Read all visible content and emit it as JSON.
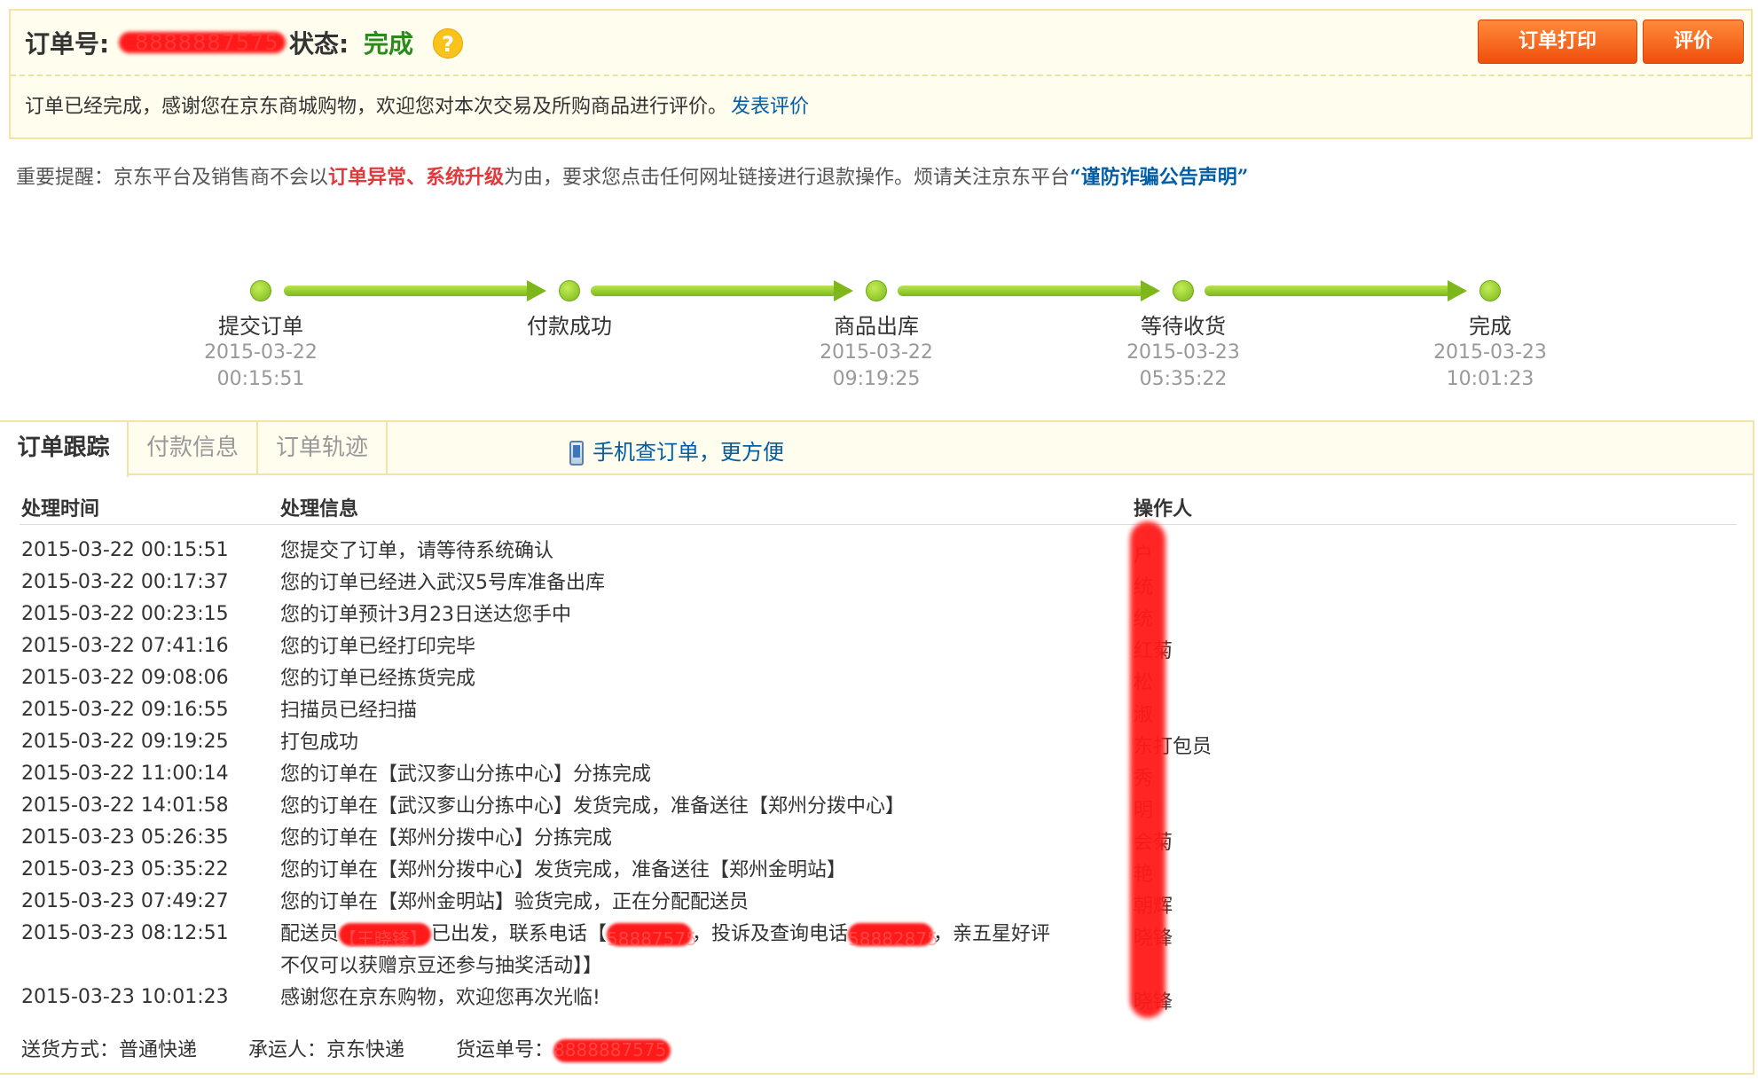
{
  "header": {
    "order_label": "订单号:",
    "order_no": "8888887575",
    "status_label": "状态:",
    "status_value": "完成",
    "help_icon": "?",
    "print_button": "订单打印",
    "review_button": "评价",
    "message": "订单已经完成，感谢您在京东商城购物，欢迎您对本次交易及所购商品进行评价。",
    "message_link": "发表评价"
  },
  "notice": {
    "prefix": "重要提醒：京东平台及销售商不会以",
    "highlight1": "订单异常、",
    "highlight2": "系统升级",
    "middle": "为由，要求您点击任何网址链接进行退款操作。烦请关注京东平台",
    "link": "“谨防诈骗公告声明”"
  },
  "progress": [
    {
      "name": "提交订单",
      "date": "2015-03-22",
      "time": "00:15:51"
    },
    {
      "name": "付款成功",
      "date": "",
      "time": ""
    },
    {
      "name": "商品出库",
      "date": "2015-03-22",
      "time": "09:19:25"
    },
    {
      "name": "等待收货",
      "date": "2015-03-23",
      "time": "05:35:22"
    },
    {
      "name": "完成",
      "date": "2015-03-23",
      "time": "10:01:23"
    }
  ],
  "tabs": {
    "tracking": "订单跟踪",
    "payment": "付款信息",
    "path": "订单轨迹",
    "mobile_link": "手机查订单，更方便"
  },
  "table": {
    "headers": {
      "time": "处理时间",
      "info": "处理信息",
      "operator": "操作人"
    },
    "rows": [
      {
        "time": "2015-03-22 00:15:51",
        "info": "您提交了订单，请等待系统确认",
        "operator": "户"
      },
      {
        "time": "2015-03-22 00:17:37",
        "info": "您的订单已经进入武汉5号库准备出库",
        "operator": "统"
      },
      {
        "time": "2015-03-22 00:23:15",
        "info": "您的订单预计3月23日送达您手中",
        "operator": "统"
      },
      {
        "time": "2015-03-22 07:41:16",
        "info": "您的订单已经打印完毕",
        "operator": "红菊"
      },
      {
        "time": "2015-03-22 09:08:06",
        "info": "您的订单已经拣货完成",
        "operator": "松"
      },
      {
        "time": "2015-03-22 09:16:55",
        "info": "扫描员已经扫描",
        "operator": "淑"
      },
      {
        "time": "2015-03-22 09:19:25",
        "info": "打包成功",
        "operator": "东打包员"
      },
      {
        "time": "2015-03-22 11:00:14",
        "info": "您的订单在【武汉奓山分拣中心】分拣完成",
        "operator": "秀"
      },
      {
        "time": "2015-03-22 14:01:58",
        "info": "您的订单在【武汉奓山分拣中心】发货完成，准备送往【郑州分拨中心】",
        "operator": "明"
      },
      {
        "time": "2015-03-23 05:26:35",
        "info": "您的订单在【郑州分拨中心】分拣完成",
        "operator": "会菊"
      },
      {
        "time": "2015-03-23 05:35:22",
        "info": "您的订单在【郑州分拨中心】发货完成，准备送往【郑州金明站】",
        "operator": "艳"
      },
      {
        "time": "2015-03-23 07:49:27",
        "info": "您的订单在【郑州金明站】验货完成，正在分配配送员",
        "operator": "朝辉"
      }
    ],
    "special_row": {
      "time": "2015-03-23 08:12:51",
      "p1": "配送员",
      "r1": "【王晓锋】",
      "p2": "已出发，联系电话【",
      "r2": "58887575",
      "p3": "，投诉及查询电话",
      "r3": "58882875",
      "p4": "，亲五星好评",
      "p5": "不仅可以获赠京豆还参与抽奖活动】】",
      "operator": "晓锋"
    },
    "last_row": {
      "time": "2015-03-23 10:01:23",
      "info": "感谢您在京东购物，欢迎您再次光临!",
      "operator": "晓锋"
    }
  },
  "footer": {
    "ship_method_label": "送货方式：",
    "ship_method": "普通快递",
    "carrier_label": "承运人：",
    "carrier": "京东快递",
    "tracking_label": "货运单号：",
    "tracking_no": "8888887575"
  },
  "colors": {
    "accent": "#f04f0c",
    "success": "#2a8a1c",
    "link": "#005ea7",
    "warning": "#e4393c",
    "progress": "#7eb71b"
  }
}
